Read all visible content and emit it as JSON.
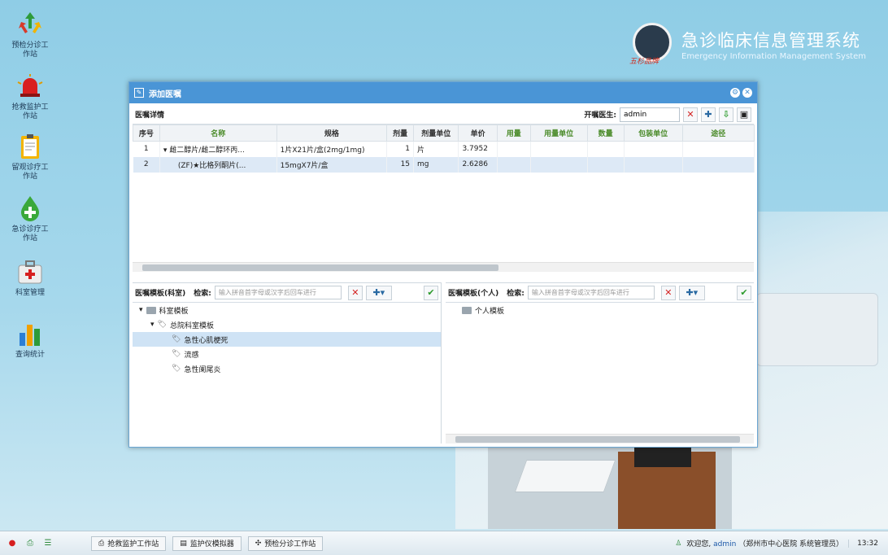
{
  "desktop_icons": [
    {
      "label_lines": [
        "预检分诊工",
        "作站"
      ],
      "icon": "triage-arrows-icon"
    },
    {
      "label_lines": [
        "抢救监护工",
        "作站"
      ],
      "icon": "alarm-light-icon"
    },
    {
      "label_lines": [
        "留观诊疗工",
        "作站"
      ],
      "icon": "clipboard-icon"
    },
    {
      "label_lines": [
        "急诊诊疗工",
        "作站"
      ],
      "icon": "drop-cross-icon"
    },
    {
      "label_lines": [
        "科室管理"
      ],
      "icon": "medical-kit-icon"
    },
    {
      "label_lines": [
        "查询统计"
      ],
      "icon": "bar-chart-icon"
    }
  ],
  "brand": {
    "title": "急诊临床信息管理系统",
    "subtitle": "Emergency Information Management System",
    "logo_text": "五杉品牌"
  },
  "window": {
    "title": "添加医嘱",
    "section_label": "医嘱详情",
    "doctor_label": "开嘱医生:",
    "doctor_value": "admin",
    "columns": [
      "序号",
      "名称",
      "规格",
      "剂量",
      "剂量单位",
      "单价",
      "用量",
      "用量单位",
      "数量",
      "包装单位",
      "途径"
    ],
    "rows": [
      {
        "no": "1",
        "expand": "▾",
        "name": "雌二醇片/雌二醇环丙...",
        "spec": "1片X21片/盒(2mg/1mg)",
        "dose": "1",
        "unit": "片",
        "price": "3.7952"
      },
      {
        "no": "2",
        "expand": "",
        "name": "(ZF)★比格列酮片(...",
        "spec": "15mgX7片/盒",
        "dose": "15",
        "unit": "mg",
        "price": "2.6286"
      }
    ],
    "left_pane": {
      "title": "医嘱模板(科室)",
      "search_label": "检索:",
      "search_placeholder": "输入拼音首字母或汉字后回车进行",
      "tree": [
        {
          "label": "科室模板",
          "level": 0,
          "kind": "folder",
          "expander": "▾"
        },
        {
          "label": "总院科室模板",
          "level": 1,
          "kind": "tag",
          "expander": "▾"
        },
        {
          "label": "急性心肌梗死",
          "level": 2,
          "kind": "tag",
          "expander": ""
        },
        {
          "label": "流感",
          "level": 2,
          "kind": "tag",
          "expander": ""
        },
        {
          "label": "急性阑尾炎",
          "level": 2,
          "kind": "tag",
          "expander": ""
        }
      ]
    },
    "right_pane": {
      "title": "医嘱模板(个人)",
      "search_label": "检索:",
      "search_placeholder": "输入拼音首字母或汉字后回车进行",
      "tree": [
        {
          "label": "个人模板",
          "kind": "folder"
        }
      ]
    }
  },
  "taskbar": {
    "tasks": [
      "抢救监护工作站",
      "监护仪模拟器",
      "预检分诊工作站"
    ],
    "welcome": "欢迎您,",
    "user": "admin",
    "org": "（郑州市中心医院 系统管理员）",
    "time": "13:32"
  },
  "colors": {
    "title_bar": "#4a95d6",
    "delete": "#d32323",
    "confirm": "#2b9a2b",
    "selected_row": "#dde9f6"
  }
}
